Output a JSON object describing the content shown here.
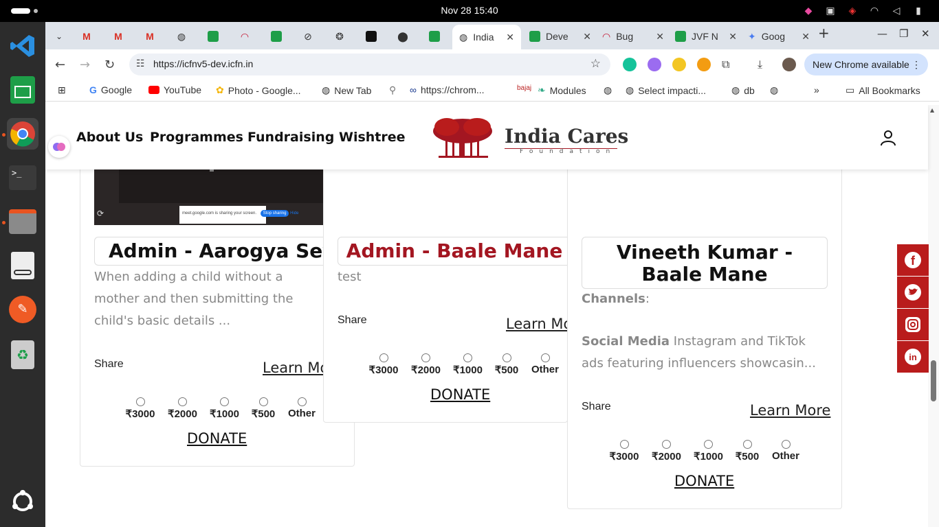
{
  "os": {
    "datetime": "Nov 28  15:40"
  },
  "browser": {
    "tabs": [
      {
        "label": "India",
        "active": true
      },
      {
        "label": "Deve"
      },
      {
        "label": "Bug"
      },
      {
        "label": "JVF N"
      },
      {
        "label": "Goog"
      }
    ],
    "url": "https://icfnv5-dev.icfn.in",
    "new_chrome_label": "New Chrome available",
    "bookmarks": [
      {
        "label": "Google"
      },
      {
        "label": "YouTube"
      },
      {
        "label": "Photo - Google..."
      },
      {
        "label": "New Tab"
      },
      {
        "label": "https://chrom..."
      },
      {
        "label": "Modules"
      },
      {
        "label": "Select impacti..."
      },
      {
        "label": "db"
      }
    ],
    "all_bookmarks_label": "All Bookmarks",
    "overflow_label": "»"
  },
  "site": {
    "nav": [
      "About Us",
      "Programmes",
      "Fundraising",
      "Wishtree"
    ],
    "logo_title": "India Cares",
    "logo_subtitle": "Foundation",
    "colors": {
      "brand": "#b91c1c",
      "title_red": "#a31621"
    }
  },
  "cards": [
    {
      "title": "Admin - Aarogya Seva",
      "image_caption": "meet.google.com is sharing your screen.",
      "image_button": "Stop sharing",
      "image_hide": "Hide",
      "description": "When adding a child without a mother and then submitting the child's basic details ...",
      "share_label": "Share",
      "learn_more": "Learn More",
      "amounts": [
        "₹3000",
        "₹2000",
        "₹1000",
        "₹500",
        "Other"
      ],
      "donate_label": "DONATE"
    },
    {
      "title": "Admin - Baale Mane",
      "description": "test",
      "share_label": "Share",
      "learn_more": "Learn More",
      "amounts": [
        "₹3000",
        "₹2000",
        "₹1000",
        "₹500",
        "Other"
      ],
      "donate_label": "DONATE"
    },
    {
      "title": "Vineeth Kumar - Baale Mane",
      "channels_label": "Channels",
      "channels_suffix": ":",
      "social_label": "Social Media",
      "social_text": " Instagram and TikTok ads featuring influencers showcasin...",
      "share_label": "Share",
      "learn_more": "Learn More",
      "amounts": [
        "₹3000",
        "₹2000",
        "₹1000",
        "₹500",
        "Other"
      ],
      "donate_label": "DONATE"
    }
  ],
  "social_icons": [
    "facebook-icon",
    "twitter-icon",
    "instagram-icon",
    "linkedin-icon"
  ]
}
